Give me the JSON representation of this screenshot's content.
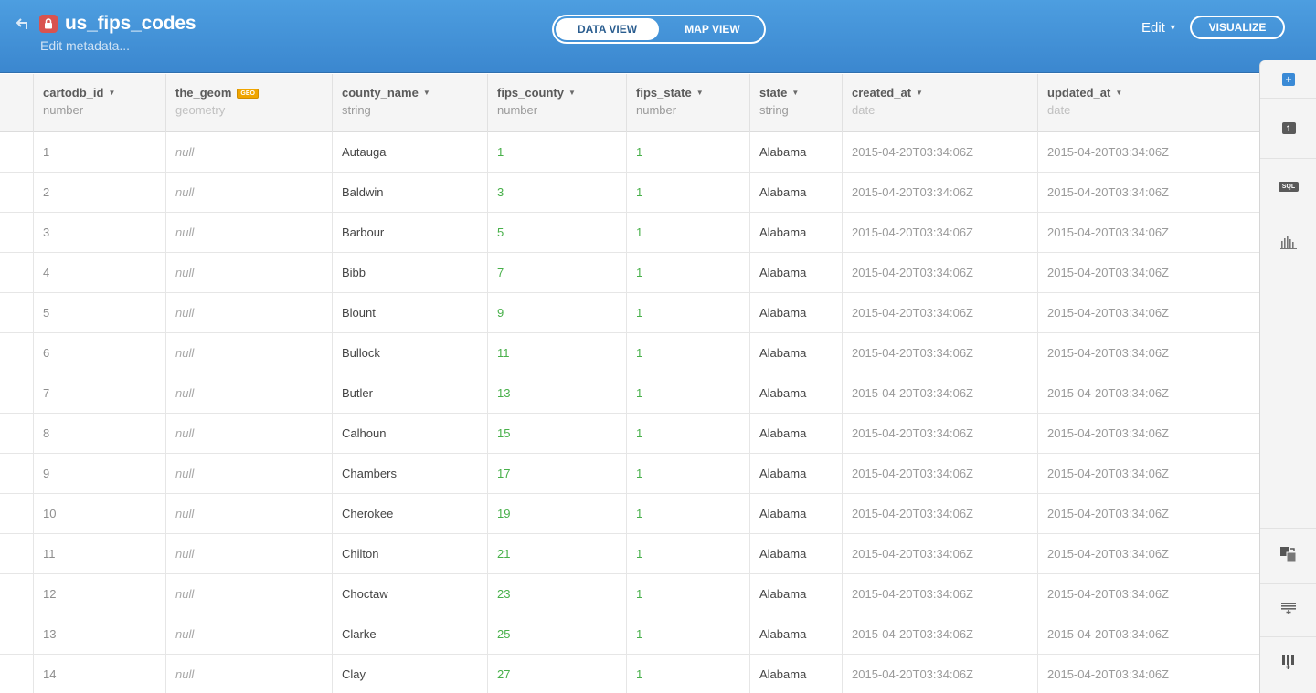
{
  "header": {
    "title": "us_fips_codes",
    "edit_metadata": "Edit metadata...",
    "view_toggle": {
      "data_view": "DATA VIEW",
      "map_view": "MAP VIEW"
    },
    "edit_label": "Edit",
    "visualize_label": "VISUALIZE",
    "accent_color": "#3b87cf"
  },
  "table": {
    "columns": [
      {
        "name": "cartodb_id",
        "type": "number"
      },
      {
        "name": "the_geom",
        "type": "geometry",
        "badge": "GEO"
      },
      {
        "name": "county_name",
        "type": "string"
      },
      {
        "name": "fips_county",
        "type": "number"
      },
      {
        "name": "fips_state",
        "type": "number"
      },
      {
        "name": "state",
        "type": "string"
      },
      {
        "name": "created_at",
        "type": "date"
      },
      {
        "name": "updated_at",
        "type": "date"
      }
    ],
    "rows": [
      [
        "1",
        "null",
        "Autauga",
        "1",
        "1",
        "Alabama",
        "2015-04-20T03:34:06Z",
        "2015-04-20T03:34:06Z"
      ],
      [
        "2",
        "null",
        "Baldwin",
        "3",
        "1",
        "Alabama",
        "2015-04-20T03:34:06Z",
        "2015-04-20T03:34:06Z"
      ],
      [
        "3",
        "null",
        "Barbour",
        "5",
        "1",
        "Alabama",
        "2015-04-20T03:34:06Z",
        "2015-04-20T03:34:06Z"
      ],
      [
        "4",
        "null",
        "Bibb",
        "7",
        "1",
        "Alabama",
        "2015-04-20T03:34:06Z",
        "2015-04-20T03:34:06Z"
      ],
      [
        "5",
        "null",
        "Blount",
        "9",
        "1",
        "Alabama",
        "2015-04-20T03:34:06Z",
        "2015-04-20T03:34:06Z"
      ],
      [
        "6",
        "null",
        "Bullock",
        "11",
        "1",
        "Alabama",
        "2015-04-20T03:34:06Z",
        "2015-04-20T03:34:06Z"
      ],
      [
        "7",
        "null",
        "Butler",
        "13",
        "1",
        "Alabama",
        "2015-04-20T03:34:06Z",
        "2015-04-20T03:34:06Z"
      ],
      [
        "8",
        "null",
        "Calhoun",
        "15",
        "1",
        "Alabama",
        "2015-04-20T03:34:06Z",
        "2015-04-20T03:34:06Z"
      ],
      [
        "9",
        "null",
        "Chambers",
        "17",
        "1",
        "Alabama",
        "2015-04-20T03:34:06Z",
        "2015-04-20T03:34:06Z"
      ],
      [
        "10",
        "null",
        "Cherokee",
        "19",
        "1",
        "Alabama",
        "2015-04-20T03:34:06Z",
        "2015-04-20T03:34:06Z"
      ],
      [
        "11",
        "null",
        "Chilton",
        "21",
        "1",
        "Alabama",
        "2015-04-20T03:34:06Z",
        "2015-04-20T03:34:06Z"
      ],
      [
        "12",
        "null",
        "Choctaw",
        "23",
        "1",
        "Alabama",
        "2015-04-20T03:34:06Z",
        "2015-04-20T03:34:06Z"
      ],
      [
        "13",
        "null",
        "Clarke",
        "25",
        "1",
        "Alabama",
        "2015-04-20T03:34:06Z",
        "2015-04-20T03:34:06Z"
      ],
      [
        "14",
        "null",
        "Clay",
        "27",
        "1",
        "Alabama",
        "2015-04-20T03:34:06Z",
        "2015-04-20T03:34:06Z"
      ]
    ]
  },
  "toolbar": {
    "icons": [
      "add-icon",
      "number-one-icon",
      "sql-icon",
      "histogram-icon",
      "merge-tables-icon",
      "add-row-icon",
      "add-column-icon"
    ],
    "sql_label": "SQL",
    "one_label": "1",
    "add_label": "+"
  }
}
